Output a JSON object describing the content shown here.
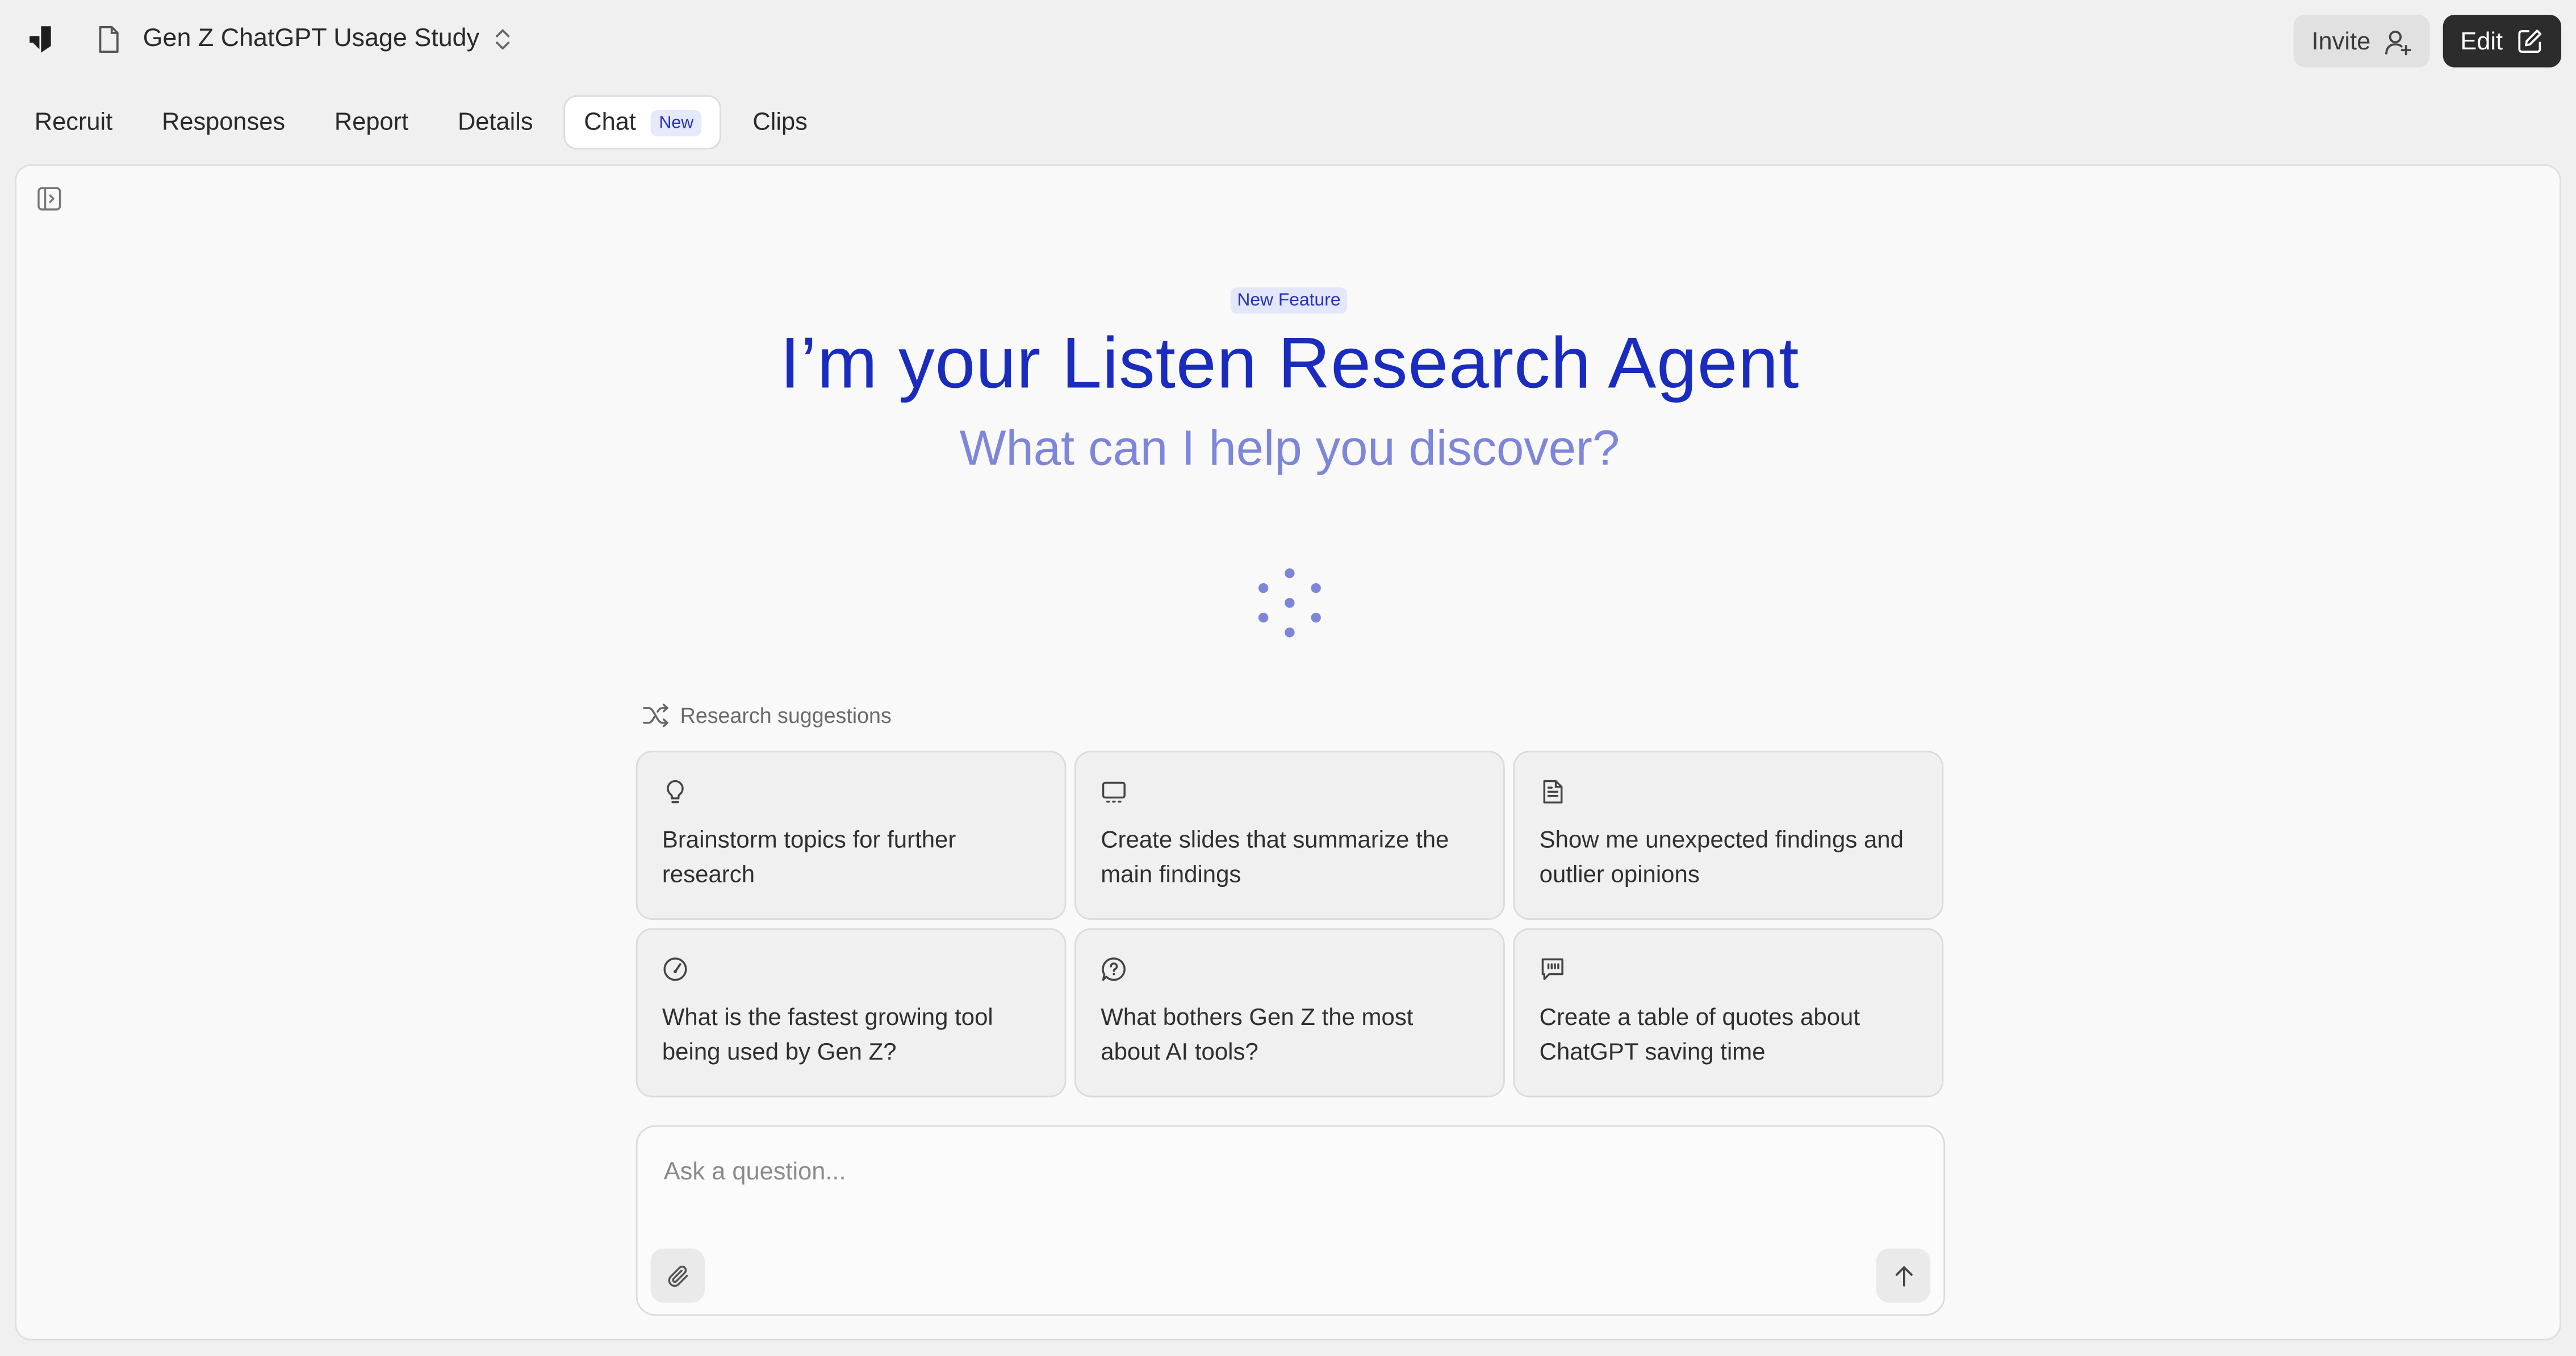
{
  "header": {
    "logo_icon": "listen-logo-icon",
    "doc_icon": "document-icon",
    "title": "Gen Z ChatGPT Usage Study",
    "switch_icon": "chevron-up-down-icon",
    "invite_label": "Invite",
    "invite_icon": "user-plus-icon",
    "edit_label": "Edit",
    "edit_icon": "pencil-square-icon"
  },
  "tabs": [
    {
      "label": "Recruit",
      "active": false
    },
    {
      "label": "Responses",
      "active": false
    },
    {
      "label": "Report",
      "active": false
    },
    {
      "label": "Details",
      "active": false
    },
    {
      "label": "Chat",
      "active": true,
      "badge": "New"
    },
    {
      "label": "Clips",
      "active": false
    }
  ],
  "main": {
    "sidebar_toggle_icon": "sidebar-toggle-icon",
    "feature_badge": "New Feature",
    "title": "I’m your Listen Research Agent",
    "subtitle": "What can I help you discover?",
    "spinner_icon": "loading-dots-icon",
    "suggestions_label": "Research suggestions",
    "suggestions_icon": "shuffle-icon",
    "suggestions": [
      {
        "icon": "lightbulb-icon",
        "text": "Brainstorm topics for further research"
      },
      {
        "icon": "presentation-icon",
        "text": "Create slides that summarize the main findings"
      },
      {
        "icon": "file-text-icon",
        "text": "Show me unexpected findings and outlier opinions"
      },
      {
        "icon": "gauge-icon",
        "text": "What is the fastest growing tool being used by Gen Z?"
      },
      {
        "icon": "question-bubble-icon",
        "text": "What bothers Gen Z the most about AI tools?"
      },
      {
        "icon": "quote-bubble-icon",
        "text": "Create a table of quotes about ChatGPT saving time"
      }
    ],
    "composer": {
      "placeholder": "Ask a question...",
      "value": "",
      "attach_icon": "paperclip-icon",
      "send_icon": "arrow-up-icon"
    }
  },
  "colors": {
    "accent": "#1a2bc0",
    "accent_soft": "#7d86d9",
    "badge_bg": "#e4e6fa",
    "dark_button": "#2c2c2c"
  }
}
